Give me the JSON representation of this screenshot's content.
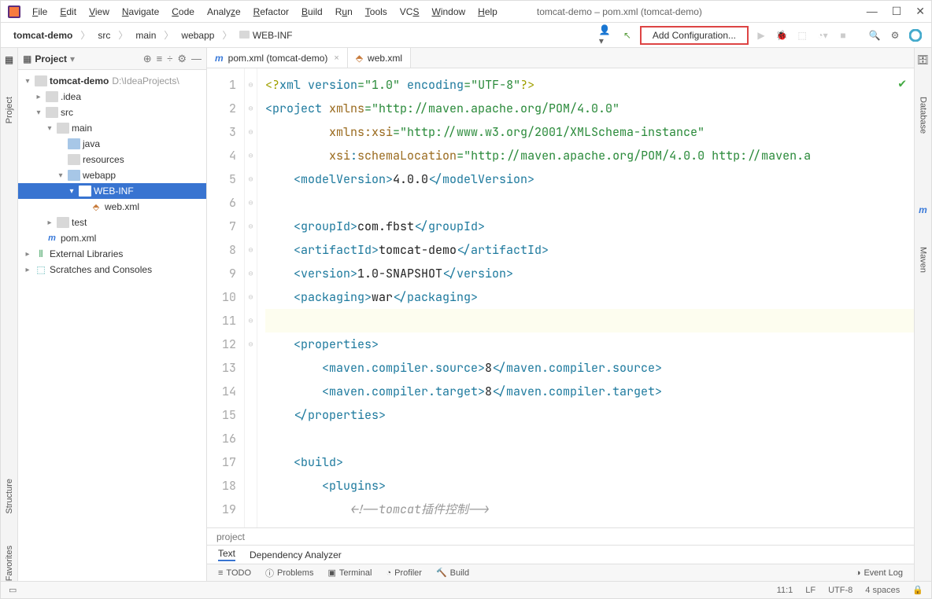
{
  "menu": {
    "file": "File",
    "edit": "Edit",
    "view": "View",
    "navigate": "Navigate",
    "code": "Code",
    "analyze": "Analyze",
    "refactor": "Refactor",
    "build": "Build",
    "run": "Run",
    "tools": "Tools",
    "vcs": "VCS",
    "window": "Window",
    "help": "Help"
  },
  "window_title": "tomcat-demo – pom.xml (tomcat-demo)",
  "breadcrumb": {
    "root": "tomcat-demo",
    "p1": "src",
    "p2": "main",
    "p3": "webapp",
    "p4": "WEB-INF"
  },
  "toolbar": {
    "add_config": "Add Configuration..."
  },
  "project": {
    "title": "Project",
    "root": "tomcat-demo",
    "root_hint": "D:\\IdeaProjects\\",
    "idea": ".idea",
    "src": "src",
    "main": "main",
    "java": "java",
    "resources": "resources",
    "webapp": "webapp",
    "webinf": "WEB-INF",
    "webxml": "web.xml",
    "test": "test",
    "pom": "pom.xml",
    "ext": "External Libraries",
    "scratch": "Scratches and Consoles"
  },
  "tabs": {
    "t1": "pom.xml (tomcat-demo)",
    "t2": "web.xml"
  },
  "code": {
    "l1a": "<?",
    "l1b": "xml version",
    "l1c": "=\"1.0\" ",
    "l1d": "encoding",
    "l1e": "=\"UTF-8\"",
    "l1f": "?>",
    "l2a": "<project ",
    "l2b": "xmlns",
    "l2c": "=\"http://maven.apache.org/POM/4.0.0\"",
    "l3a": "         ",
    "l3b": "xmlns:xsi",
    "l3c": "=\"http://www.w3.org/2001/XMLSchema-instance\"",
    "l4a": "         ",
    "l4b": "xsi",
    "l4c": ":",
    "l4d": "schemaLocation",
    "l4e": "=\"http://maven.apache.org/POM/4.0.0 http://maven.a",
    "l5a": "    <modelVersion>",
    "l5b": "4.0.0",
    "l5c": "</modelVersion>",
    "l7a": "    <groupId>",
    "l7b": "com.fbst",
    "l7c": "</groupId>",
    "l8a": "    <artifactId>",
    "l8b": "tomcat-demo",
    "l8c": "</artifactId>",
    "l9a": "    <version>",
    "l9b": "1.0-SNAPSHOT",
    "l9c": "</version>",
    "l10a": "    <packaging>",
    "l10b": "war",
    "l10c": "</packaging>",
    "l12a": "    <properties>",
    "l13a": "        <maven.compiler.source>",
    "l13b": "8",
    "l13c": "</maven.compiler.source>",
    "l14a": "        <maven.compiler.target>",
    "l14b": "8",
    "l14c": "</maven.compiler.target>",
    "l15a": "    </properties>",
    "l17a": "    <build>",
    "l18a": "        <plugins>",
    "l19a": "            ",
    "l19b": "<!--tomcat插件控制-->"
  },
  "crumb_bottom": "project",
  "bottom_tabs": {
    "t1": "Text",
    "t2": "Dependency Analyzer"
  },
  "toolwindows": {
    "todo": "TODO",
    "problems": "Problems",
    "terminal": "Terminal",
    "profiler": "Profiler",
    "build": "Build",
    "eventlog": "Event Log"
  },
  "status": {
    "pos": "11:1",
    "lf": "LF",
    "enc": "UTF-8",
    "indent": "4 spaces"
  },
  "gutters": {
    "project": "Project",
    "structure": "Structure",
    "favorites": "Favorites",
    "database": "Database",
    "maven": "Maven"
  },
  "line_numbers": [
    "1",
    "2",
    "3",
    "4",
    "5",
    "6",
    "7",
    "8",
    "9",
    "10",
    "11",
    "12",
    "13",
    "14",
    "15",
    "16",
    "17",
    "18",
    "19"
  ]
}
